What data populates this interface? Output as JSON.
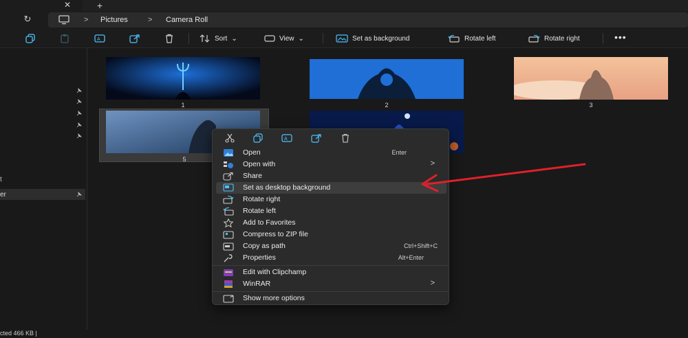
{
  "tabs": {
    "close_glyph": "✕",
    "add_glyph": "+"
  },
  "address": {
    "refresh_glyph": "↻",
    "crumbs": [
      "Pictures",
      "Camera Roll"
    ],
    "separator": ">"
  },
  "toolbar": {
    "sort_label": "Sort",
    "view_label": "View",
    "set_background_label": "Set as background",
    "rotate_left_label": "Rotate left",
    "rotate_right_label": "Rotate right",
    "more_label": "•••",
    "chevron": "⌄"
  },
  "nav": {
    "selected_fragment": "er",
    "fragment_two": "t"
  },
  "thumbnails": [
    {
      "label": "1"
    },
    {
      "label": "2"
    },
    {
      "label": "3"
    },
    {
      "label": "5"
    }
  ],
  "status": {
    "text": "cted  466 KB  |"
  },
  "context_menu": {
    "items": [
      {
        "label": "Open",
        "shortcut": "Enter"
      },
      {
        "label": "Open with",
        "arrow": ">"
      },
      {
        "label": "Share"
      },
      {
        "label": "Set as desktop background"
      },
      {
        "label": "Rotate right"
      },
      {
        "label": "Rotate left"
      },
      {
        "label": "Add to Favorites"
      },
      {
        "label": "Compress to ZIP file"
      },
      {
        "label": "Copy as path",
        "shortcut": "Ctrl+Shift+C"
      },
      {
        "label": "Properties",
        "shortcut": "Alt+Enter"
      },
      {
        "label": "Edit with Clipchamp"
      },
      {
        "label": "WinRAR",
        "arrow": ">"
      },
      {
        "label": "Show more options"
      }
    ]
  },
  "colors": {
    "accent": "#4cc2ff",
    "annotation": "#e0202a",
    "menu_bg": "#2b2b2b"
  }
}
